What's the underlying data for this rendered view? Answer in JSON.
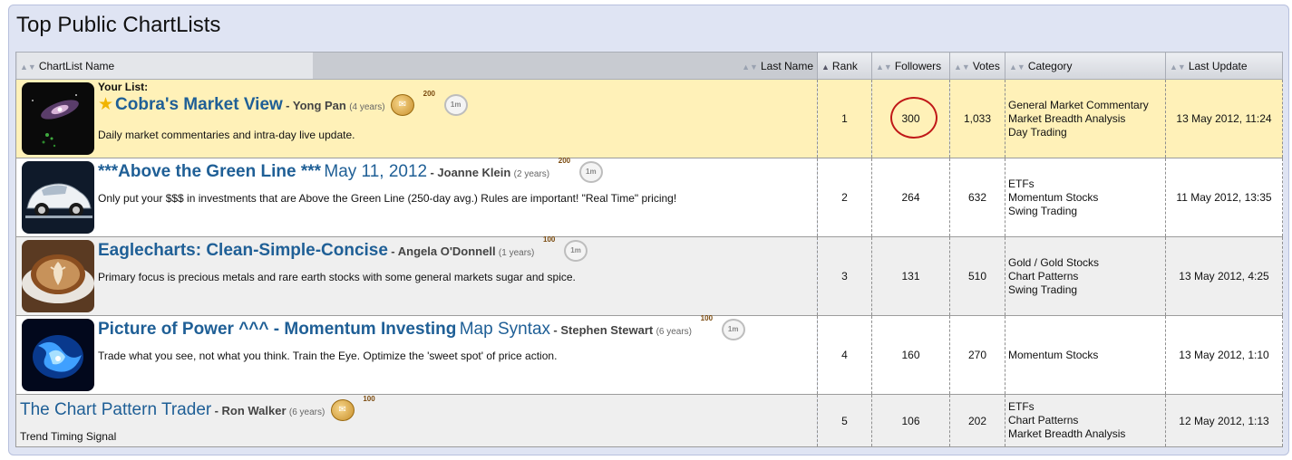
{
  "page": {
    "title": "Top Public ChartLists"
  },
  "columns": {
    "name": "ChartList Name",
    "last_name": "Last Name",
    "rank": "Rank",
    "followers": "Followers",
    "votes": "Votes",
    "category": "Category",
    "last_update": "Last Update"
  },
  "your_list_label": "Your List:",
  "rows": [
    {
      "title": "Cobra's Market View",
      "subtitle": "",
      "author": "Yong Pan",
      "years": "(4 years)",
      "description": "Daily market commentaries and intra-day live update.",
      "badges": {
        "medal": "",
        "ribbon": "200",
        "laurel": "1m"
      },
      "rank": "1",
      "followers": "300",
      "votes": "1,033",
      "categories": [
        "General Market Commentary",
        "Market Breadth Analysis",
        "Day Trading"
      ],
      "last_update": "13 May 2012, 11:24"
    },
    {
      "title": "***Above the Green Line ***",
      "subtitle": "May 11, 2012",
      "author": "Joanne Klein",
      "years": "(2 years)",
      "description": "Only put your $$$ in investments that are Above the Green Line (250-day avg.) Rules are important! \"Real Time\" pricing!",
      "badges": {
        "ribbon": "200",
        "laurel": "1m"
      },
      "rank": "2",
      "followers": "264",
      "votes": "632",
      "categories": [
        "ETFs",
        "Momentum Stocks",
        "Swing Trading"
      ],
      "last_update": "11 May 2012, 13:35"
    },
    {
      "title": "Eaglecharts: Clean-Simple-Concise",
      "subtitle": "",
      "author": "Angela O'Donnell",
      "years": "(1 years)",
      "description": "Primary focus is precious metals and rare earth stocks with some general markets sugar and spice.",
      "badges": {
        "ribbon": "100",
        "laurel": "1m"
      },
      "rank": "3",
      "followers": "131",
      "votes": "510",
      "categories": [
        "Gold / Gold Stocks",
        "Chart Patterns",
        "Swing Trading"
      ],
      "last_update": "13 May 2012, 4:25"
    },
    {
      "title": "Picture of Power ^^^ - Momentum Investing",
      "subtitle": "Map Syntax",
      "author": "Stephen Stewart",
      "years": "(6 years)",
      "description": "Trade what you see, not what you think. Train the Eye. Optimize the 'sweet spot' of price action.",
      "badges": {
        "ribbon": "100",
        "laurel": "1m"
      },
      "rank": "4",
      "followers": "160",
      "votes": "270",
      "categories": [
        "Momentum Stocks"
      ],
      "last_update": "13 May 2012, 1:10"
    },
    {
      "title": "The Chart Pattern Trader",
      "subtitle": "",
      "author": "Ron Walker",
      "years": "(6 years)",
      "description": "Trend Timing Signal",
      "badges": {
        "medal": "",
        "ribbon": "100"
      },
      "rank": "5",
      "followers": "106",
      "votes": "202",
      "categories": [
        "ETFs",
        "Chart Patterns",
        "Market Breadth Analysis"
      ],
      "last_update": "12 May 2012, 1:13"
    }
  ],
  "colors": {
    "link": "#1f5f96",
    "highlight_row": "#fff1b8",
    "panel_bg": "#dfe4f3",
    "annotation_circle": "#c01818"
  }
}
